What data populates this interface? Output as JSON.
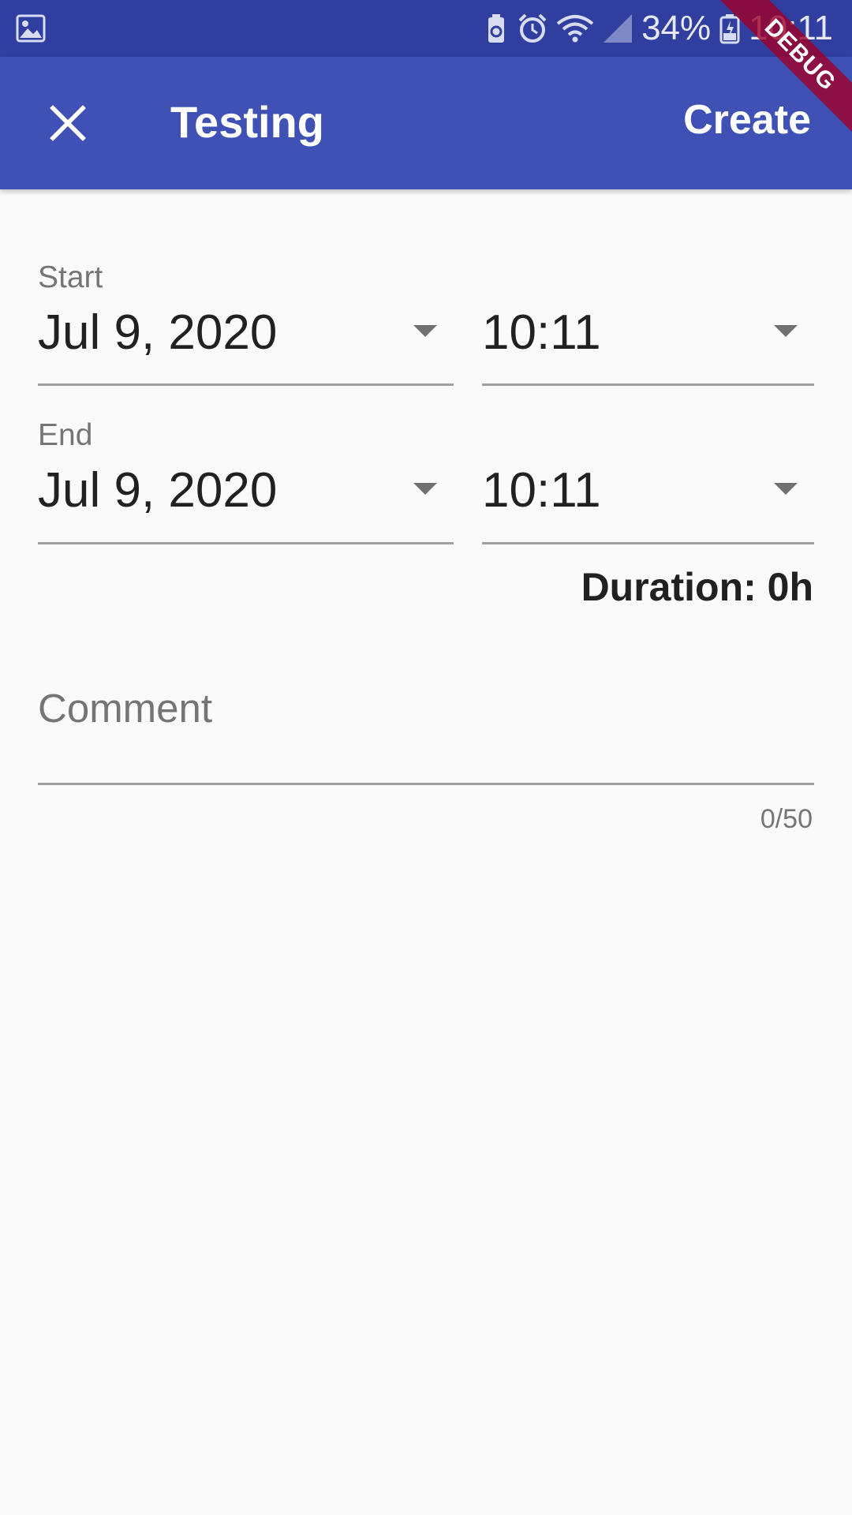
{
  "status_bar": {
    "battery_percent": "34%",
    "time": "10:11",
    "icons": [
      "gallery-icon",
      "battery-saver-icon",
      "alarm-icon",
      "wifi-icon",
      "signal-icon",
      "battery-icon"
    ]
  },
  "app_bar": {
    "close_icon": "close-icon",
    "title": "Testing",
    "action_label": "Create"
  },
  "debug_banner": "DEBUG",
  "form": {
    "start": {
      "label": "Start",
      "date": "Jul 9, 2020",
      "time": "10:11"
    },
    "end": {
      "label": "End",
      "date": "Jul 9, 2020",
      "time": "10:11"
    },
    "duration": "Duration: 0h",
    "comment": {
      "placeholder": "Comment",
      "counter": "0/50"
    }
  },
  "colors": {
    "status_bar": "#303f9f",
    "app_bar": "#3f51b5",
    "background": "#fafafa",
    "debug_ribbon": "#a00028"
  }
}
